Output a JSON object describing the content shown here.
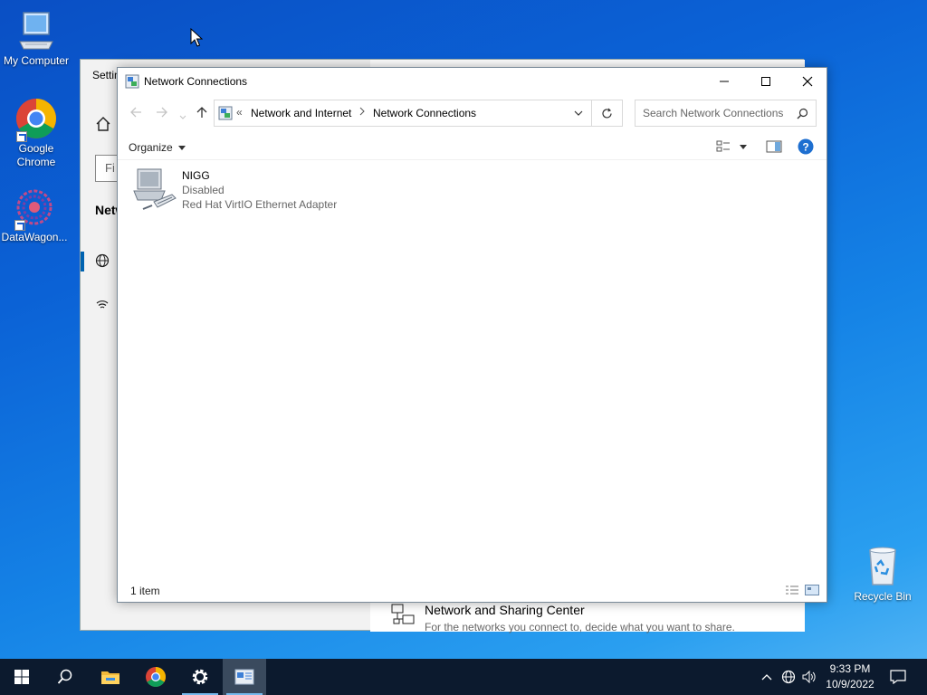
{
  "desktop": {
    "icons": [
      {
        "label": "My Computer",
        "icon": "monitor-icon"
      },
      {
        "label": "Google Chrome",
        "icon": "chrome-icon"
      },
      {
        "label": "DataWagon...",
        "icon": "datawagon-icon"
      },
      {
        "label": "Recycle Bin",
        "icon": "recycle-bin-icon"
      }
    ]
  },
  "settings_window": {
    "title": "Settin",
    "find_placeholder": "Fi",
    "heading": "Netw",
    "sharing_center": {
      "title": "Network and Sharing Center",
      "description": "For the networks you connect to, decide what you want to share."
    }
  },
  "network_window": {
    "title": "Network Connections",
    "breadcrumb": {
      "overflow": "«",
      "items": [
        "Network and Internet",
        "Network Connections"
      ]
    },
    "search_placeholder": "Search Network Connections",
    "toolbar": {
      "organize_label": "Organize"
    },
    "items": [
      {
        "name": "NIGG",
        "status": "Disabled",
        "device": "Red Hat VirtIO Ethernet Adapter"
      }
    ],
    "status_count": "1 item"
  },
  "taskbar": {
    "items": [
      "start-icon",
      "search-icon",
      "file-explorer-icon",
      "chrome-icon",
      "settings-icon",
      "network-connections-icon"
    ],
    "clock": {
      "time": "9:33 PM",
      "date": "10/9/2022"
    }
  },
  "colors": {
    "accent": "#0063b1",
    "taskbar": "#0c1a2e",
    "help": "#1e6fd0"
  }
}
